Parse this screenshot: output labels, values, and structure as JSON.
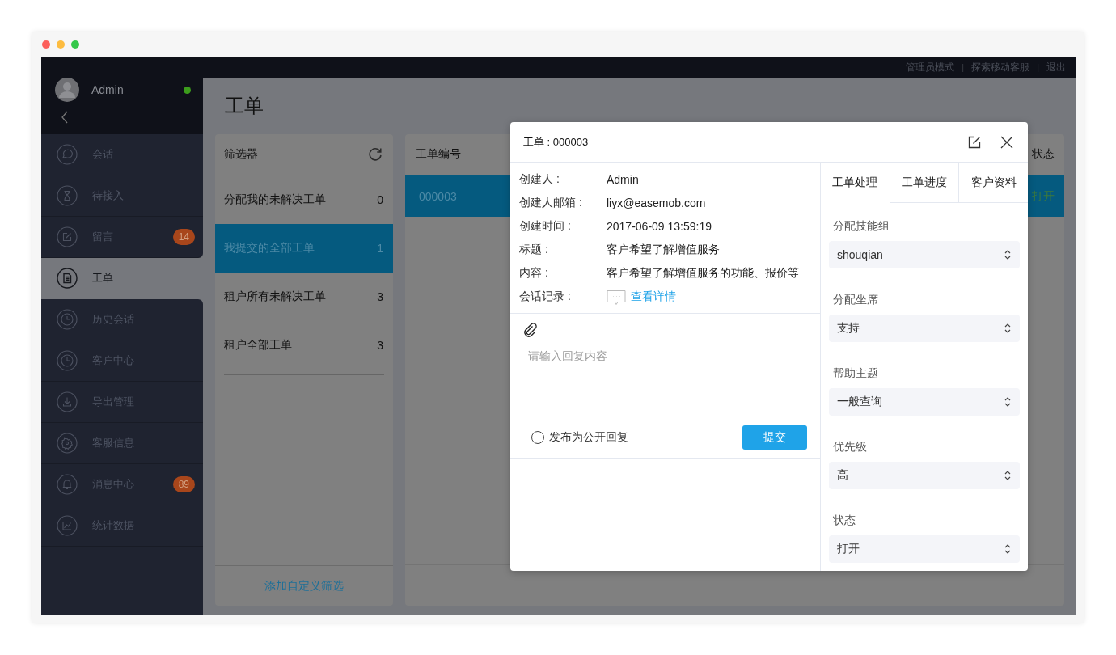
{
  "top_bar": [
    {
      "kind": "link",
      "text": "管理员模式"
    },
    {
      "kind": "separator",
      "text": "|"
    },
    {
      "kind": "link",
      "text": "探索移动客服"
    },
    {
      "kind": "separator",
      "text": "|"
    },
    {
      "kind": "link",
      "text": "退出"
    }
  ],
  "user": {
    "name": "Admin",
    "online": true
  },
  "sidebar": {
    "items": [
      {
        "label": "会话",
        "kind": "chat",
        "selected": false
      },
      {
        "label": "待接入",
        "kind": "hourglass",
        "selected": false
      },
      {
        "label": "留言",
        "kind": "edit",
        "badge": "14",
        "selected": false
      },
      {
        "label": "工单",
        "kind": "document",
        "selected": true
      },
      {
        "label": "历史会话",
        "kind": "clock",
        "selected": false
      },
      {
        "label": "客户中心",
        "kind": "clock",
        "selected": false
      },
      {
        "label": "导出管理",
        "kind": "download",
        "selected": false
      },
      {
        "label": "客服信息",
        "kind": "gear",
        "selected": false
      },
      {
        "label": "消息中心",
        "kind": "bell",
        "badge": "89",
        "selected": false
      },
      {
        "label": "统计数据",
        "kind": "chart",
        "selected": false
      }
    ]
  },
  "page_title": "工单",
  "filters": {
    "title": "筛选器",
    "items": [
      {
        "label": "分配我的未解决工单",
        "count": "0",
        "selected": false
      },
      {
        "label": "我提交的全部工单",
        "count": "1",
        "selected": true
      },
      {
        "label": "租户所有未解决工单",
        "count": "3",
        "selected": false
      },
      {
        "label": "租户全部工单",
        "count": "3",
        "selected": false
      }
    ],
    "add_link": "添加自定义筛选"
  },
  "table": {
    "columns": [
      "工单编号",
      "状态"
    ],
    "rows": [
      {
        "cells": [
          "000003",
          "打开"
        ],
        "selected": true
      }
    ]
  },
  "dialog": {
    "title": "工单 : 000003",
    "fields": [
      {
        "label": "创建人 :",
        "value": "Admin"
      },
      {
        "label": "创建人邮箱 :",
        "value": "liyx@easemob.com"
      },
      {
        "label": "创建时间 :",
        "value": "2017-06-09 13:59:19"
      },
      {
        "label": "标题 :",
        "value": "客户希望了解增值服务"
      },
      {
        "label": "内容 :",
        "value": "客户希望了解增值服务的功能、报价等"
      },
      {
        "label": "会话记录 :",
        "link": "查看详情"
      }
    ],
    "reply": {
      "placeholder": "请输入回复内容",
      "public_label": "发布为公开回复",
      "public": false,
      "submit": "提交"
    },
    "tabs": [
      {
        "label": "工单处理",
        "selected": true
      },
      {
        "label": "工单进度",
        "selected": false
      },
      {
        "label": "客户资料",
        "selected": false
      }
    ],
    "form": [
      {
        "label": "分配技能组",
        "value": "shouqian"
      },
      {
        "label": "分配坐席",
        "value": "支持"
      },
      {
        "label": "帮助主题",
        "value": "一般查询"
      },
      {
        "label": "优先级",
        "value": "高"
      },
      {
        "label": "状态",
        "value": "打开"
      }
    ]
  }
}
